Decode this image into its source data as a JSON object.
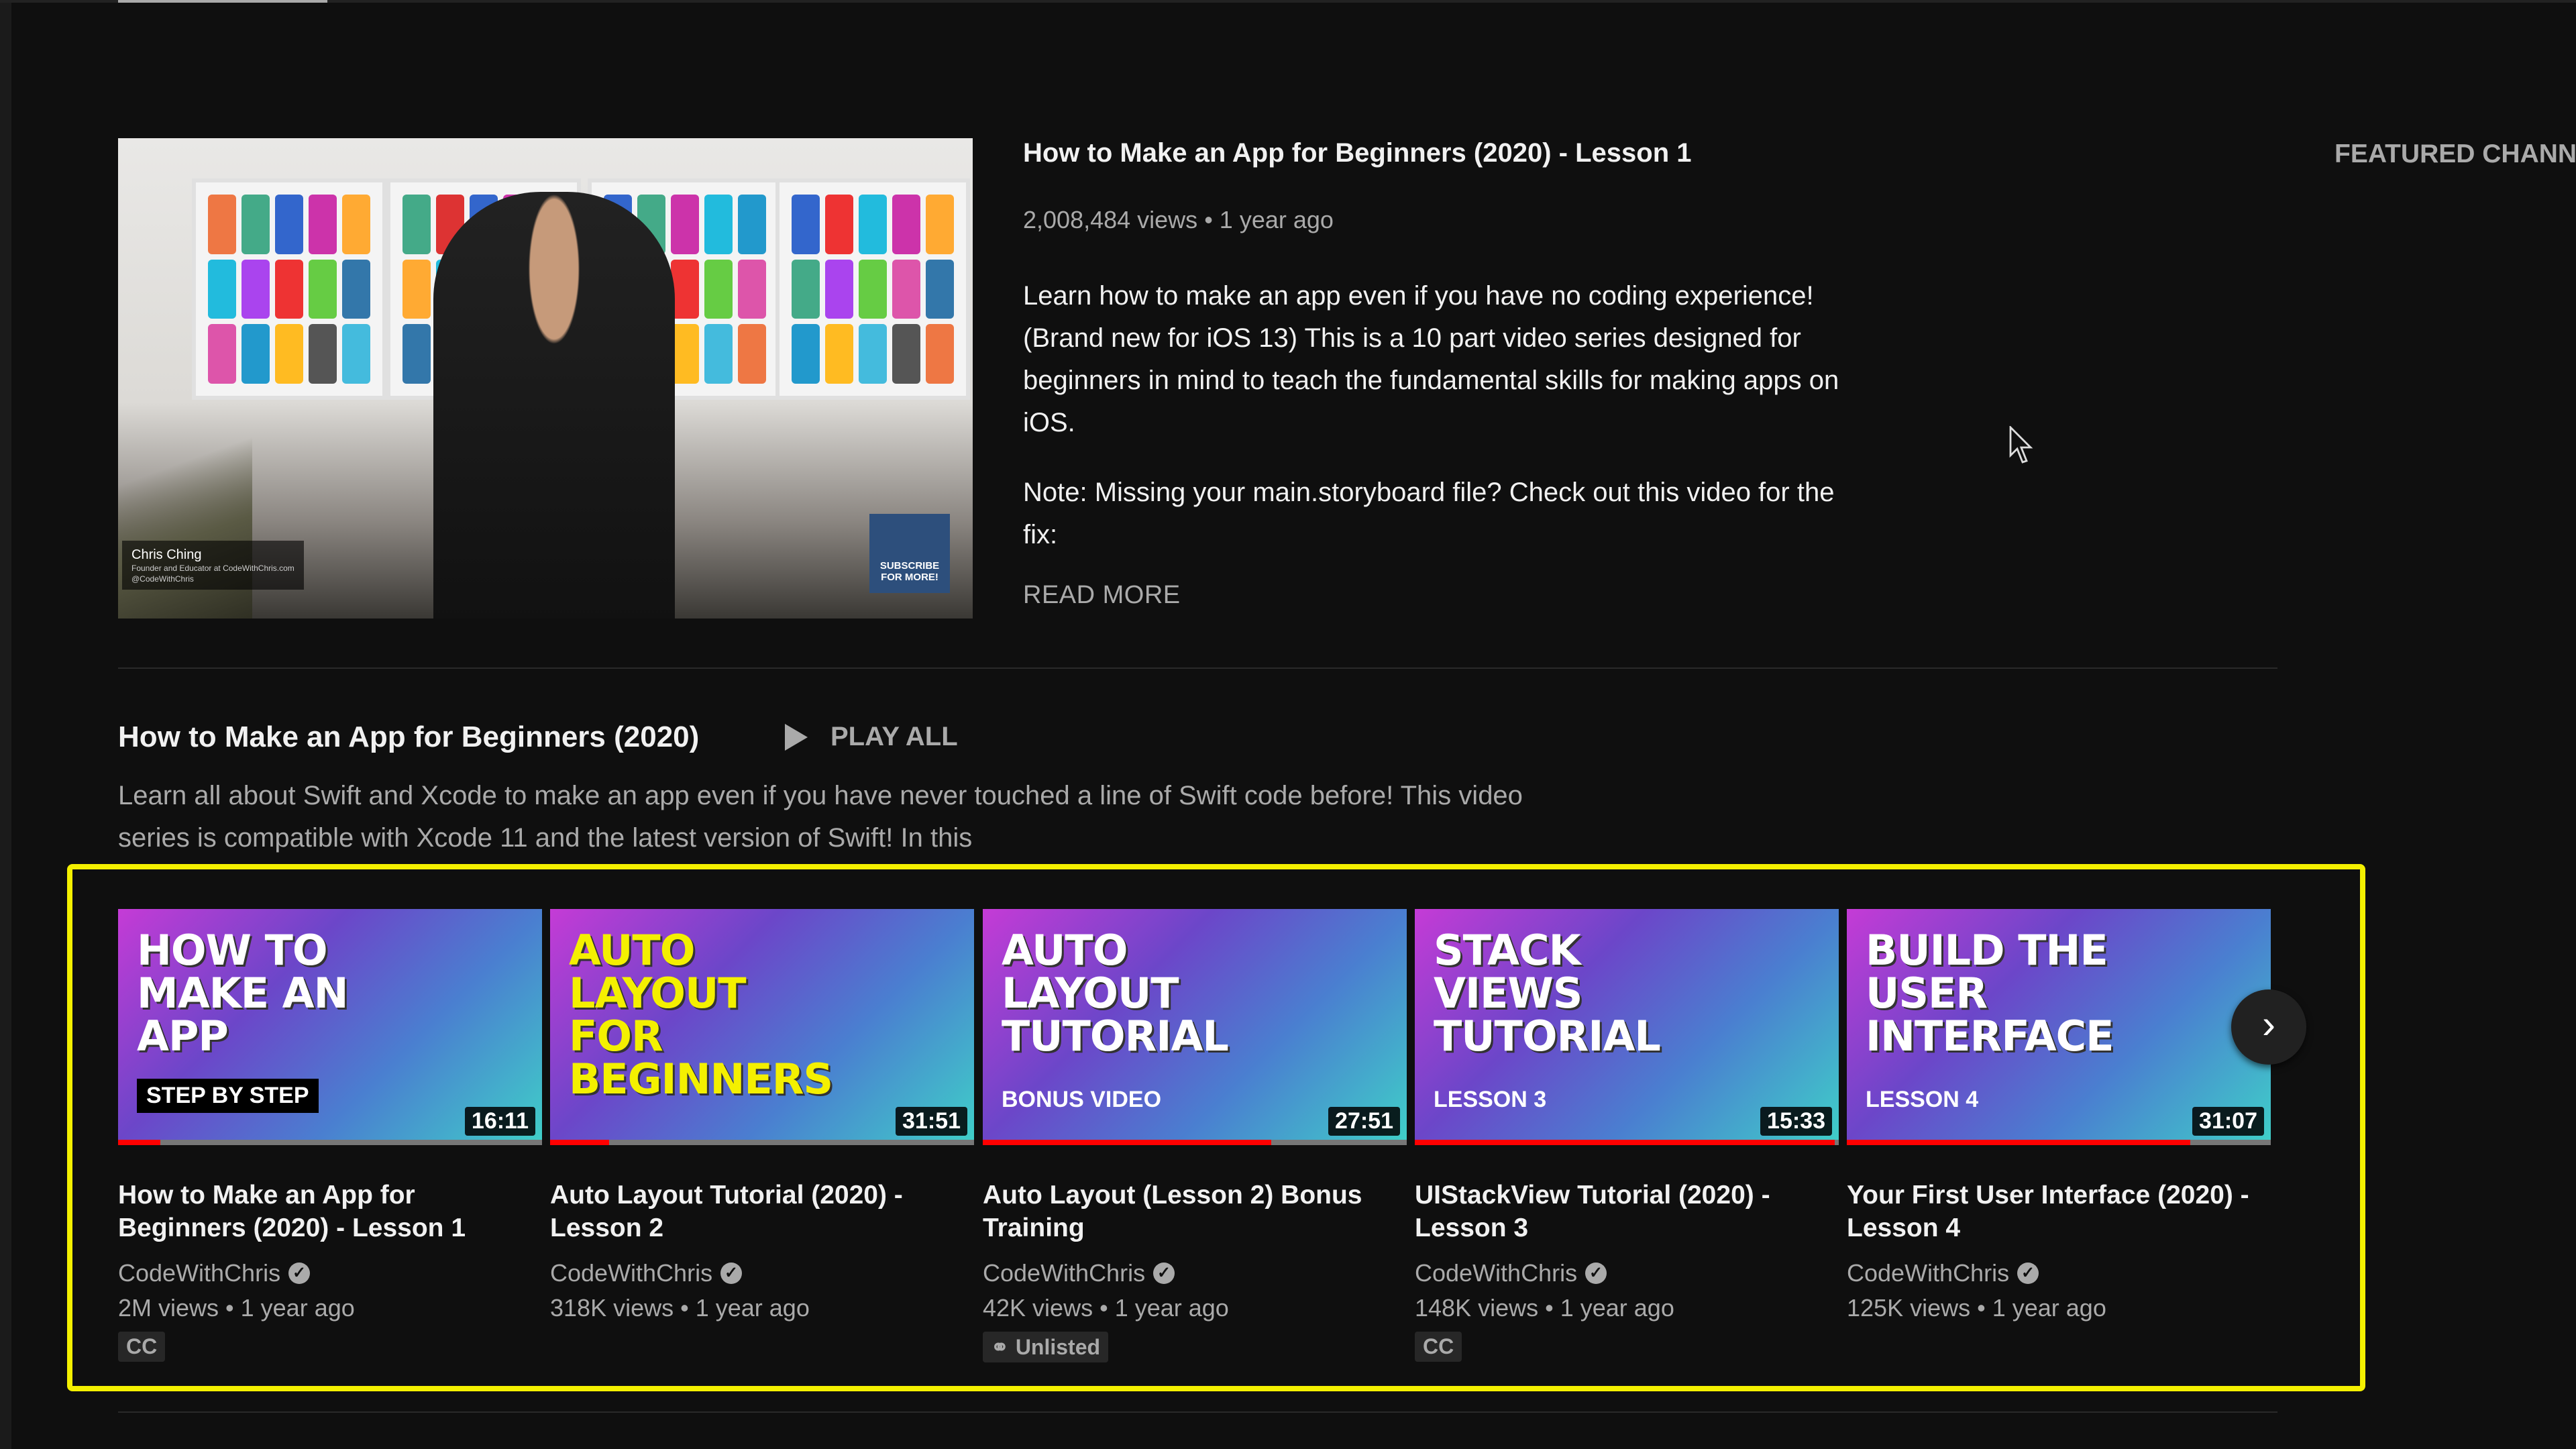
{
  "featured_video": {
    "title": "How to Make an App for Beginners (2020) - Lesson 1",
    "views": "2,008,484 views",
    "age": "1 year ago",
    "description": "Learn how to make an app even if you have no coding experience! (Brand new for iOS 13) This is a 10 part video series designed for beginners in mind to teach the fundamental skills for making apps on iOS.",
    "note": "Note: Missing your main.storyboard file? Check out this video for the fix:",
    "read_more": "READ MORE",
    "thumb_name": "Chris Ching",
    "thumb_role": "Founder and Educator at CodeWithChris.com",
    "thumb_handle": "@CodeWithChris",
    "thumb_subscribe": "SUBSCRIBE FOR MORE!"
  },
  "featured_channels_label": "FEATURED CHANN",
  "playlist": {
    "title": "How to Make an App for Beginners (2020)",
    "play_all": "PLAY ALL",
    "description": "Learn all about Swift and Xcode to make an app even if you have never touched a line of Swift code before! This video series is compatible with Xcode 11 and the latest version of Swift! In this",
    "highlight_color": "#f4f000",
    "videos": [
      {
        "thumb_text": "HOW TO MAKE AN APP",
        "thumb_sub": "STEP BY STEP",
        "duration": "16:11",
        "progress": 0.1,
        "title": "How to Make an App for Beginners (2020) - Lesson 1",
        "channel": "CodeWithChris",
        "views": "2M views",
        "age": "1 year ago",
        "badge": "CC"
      },
      {
        "thumb_text": "AUTO LAYOUT FOR BEGINNERS",
        "thumb_sub": "",
        "duration": "31:51",
        "progress": 0.14,
        "title": "Auto Layout Tutorial (2020) - Lesson 2",
        "channel": "CodeWithChris",
        "views": "318K views",
        "age": "1 year ago",
        "badge": ""
      },
      {
        "thumb_text": "AUTO LAYOUT TUTORIAL",
        "thumb_sub": "BONUS VIDEO",
        "duration": "27:51",
        "progress": 0.68,
        "title": "Auto Layout (Lesson 2) Bonus Training",
        "channel": "CodeWithChris",
        "views": "42K views",
        "age": "1 year ago",
        "badge": "Unlisted"
      },
      {
        "thumb_text": "STACK VIEWS TUTORIAL",
        "thumb_sub": "LESSON 3",
        "duration": "15:33",
        "progress": 0.99,
        "title": "UIStackView Tutorial (2020) - Lesson 3",
        "channel": "CodeWithChris",
        "views": "148K views",
        "age": "1 year ago",
        "badge": "CC"
      },
      {
        "thumb_text": "BUILD THE USER INTERFACE",
        "thumb_sub": "LESSON 4",
        "duration": "31:07",
        "progress": 0.81,
        "title": "Your First User Interface (2020) - Lesson 4",
        "channel": "CodeWithChris",
        "views": "125K views",
        "age": "1 year ago",
        "badge": ""
      }
    ]
  },
  "icons": {
    "play": "play-icon",
    "next": "chevron-right-icon",
    "verified": "verified-check-icon",
    "link": "link-icon",
    "cursor": "mouse-pointer"
  }
}
